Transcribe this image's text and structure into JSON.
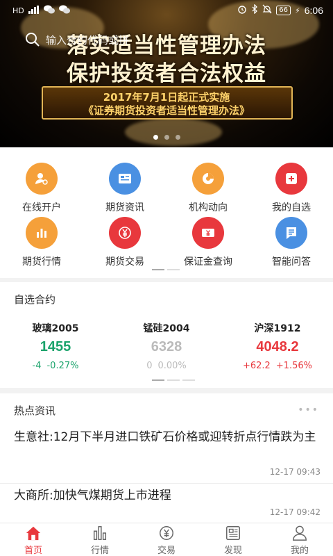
{
  "status_bar": {
    "left_icons": [
      "HD",
      "4G",
      "wechat-icon",
      "wechat-icon"
    ],
    "right_icons": [
      "alarm-icon",
      "bluetooth-icon",
      "mute-icon"
    ],
    "battery": "66",
    "time": "6:06"
  },
  "banner": {
    "search_placeholder": "输入合约代码或拼",
    "title_line1": "落实适当性管理办法",
    "title_line2": "保护投资者合法权益",
    "subtitle_line1": "2017年7月1日起正式实施",
    "subtitle_line2": "《证券期货投资者适当性管理办法》",
    "slide_count": 3,
    "active_slide": 1
  },
  "menu": {
    "items": [
      {
        "label": "在线开户",
        "icon": "open-account-icon",
        "color": "#f5a03a"
      },
      {
        "label": "期货资讯",
        "icon": "news-icon",
        "color": "#4a90e2"
      },
      {
        "label": "机构动向",
        "icon": "pie-chart-icon",
        "color": "#f5a03a"
      },
      {
        "label": "我的自选",
        "icon": "add-favorite-icon",
        "color": "#e8383d"
      },
      {
        "label": "期货行情",
        "icon": "bar-chart-icon",
        "color": "#f5a03a"
      },
      {
        "label": "期货交易",
        "icon": "yen-icon",
        "color": "#e8383d"
      },
      {
        "label": "保证金查询",
        "icon": "yen-card-icon",
        "color": "#e8383d"
      },
      {
        "label": "智能问答",
        "icon": "qa-icon",
        "color": "#4a90e2"
      }
    ]
  },
  "watchlist": {
    "title": "自选合约",
    "quotes": [
      {
        "name": "玻璃2005",
        "price": "1455",
        "change": "-4",
        "pct": "-0.27%",
        "color": "#1aa36b"
      },
      {
        "name": "锰硅2004",
        "price": "6328",
        "change": "0",
        "pct": "0.00%",
        "color": "#bbbbbb"
      },
      {
        "name": "沪深1912",
        "price": "4048.2",
        "change": "+62.2",
        "pct": "+1.56%",
        "color": "#e8383d"
      }
    ]
  },
  "news": {
    "title": "热点资讯",
    "more": "•••",
    "items": [
      {
        "title": "生意社:12月下半月进口铁矿石价格或迎转折点行情跌为主",
        "time": "12-17 09:43"
      },
      {
        "title": "大商所:加快气煤期货上市进程",
        "time": "12-17 09:42"
      }
    ]
  },
  "tabbar": {
    "active_color": "#e8383d",
    "inactive_color": "#666666",
    "tabs": [
      {
        "label": "首页",
        "icon": "home-icon",
        "active": true
      },
      {
        "label": "行情",
        "icon": "market-icon",
        "active": false
      },
      {
        "label": "交易",
        "icon": "trade-icon",
        "active": false
      },
      {
        "label": "发现",
        "icon": "discover-icon",
        "active": false
      },
      {
        "label": "我的",
        "icon": "profile-icon",
        "active": false
      }
    ]
  }
}
